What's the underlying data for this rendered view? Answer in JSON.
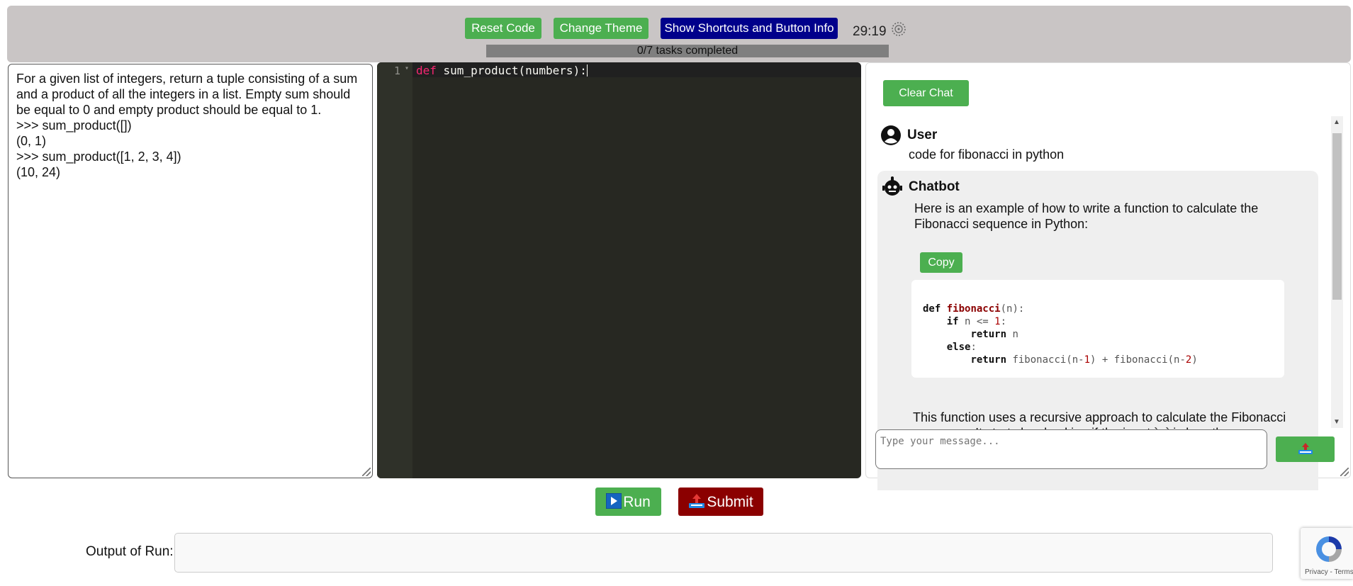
{
  "toolbar": {
    "reset_label": "Reset Code",
    "theme_label": "Change Theme",
    "shortcuts_label": "Show Shortcuts and Button Info",
    "timer": "29:19",
    "progress": {
      "completed": 0,
      "total": 7,
      "label": "0/7 tasks completed"
    }
  },
  "problem": {
    "text": "For a given list of integers, return a tuple consisting of a sum and a product of all the integers in a list. Empty sum should be equal to 0 and empty product should be equal to 1.\n>>> sum_product([])\n(0, 1)\n>>> sum_product([1, 2, 3, 4])\n(10, 24)"
  },
  "editor": {
    "line_number": "1",
    "keyword": "def",
    "code": " sum_product(numbers):"
  },
  "chat": {
    "clear_label": "Clear Chat",
    "user_name": "User",
    "user_message": "code for fibonacci in python",
    "bot_name": "Chatbot",
    "bot_intro": "Here is an example of how to write a function to calculate the Fibonacci sequence in Python:",
    "copy_label": "Copy",
    "bot_after": "This function uses a recursive approach to calculate the Fibonacci sequence. It starts by checking if the input `n` is less th",
    "input_placeholder": "Type your message..."
  },
  "actions": {
    "run_label": "Run",
    "submit_label": "Submit"
  },
  "output": {
    "label": "Output of Run:",
    "value": ""
  },
  "recaptcha": {
    "links": "Privacy - Terms"
  },
  "colors": {
    "topbar": "#c9c5c5",
    "green": "#4caf50",
    "navy": "#00008b",
    "submit": "#8b0000",
    "editor_bg": "#272822"
  }
}
